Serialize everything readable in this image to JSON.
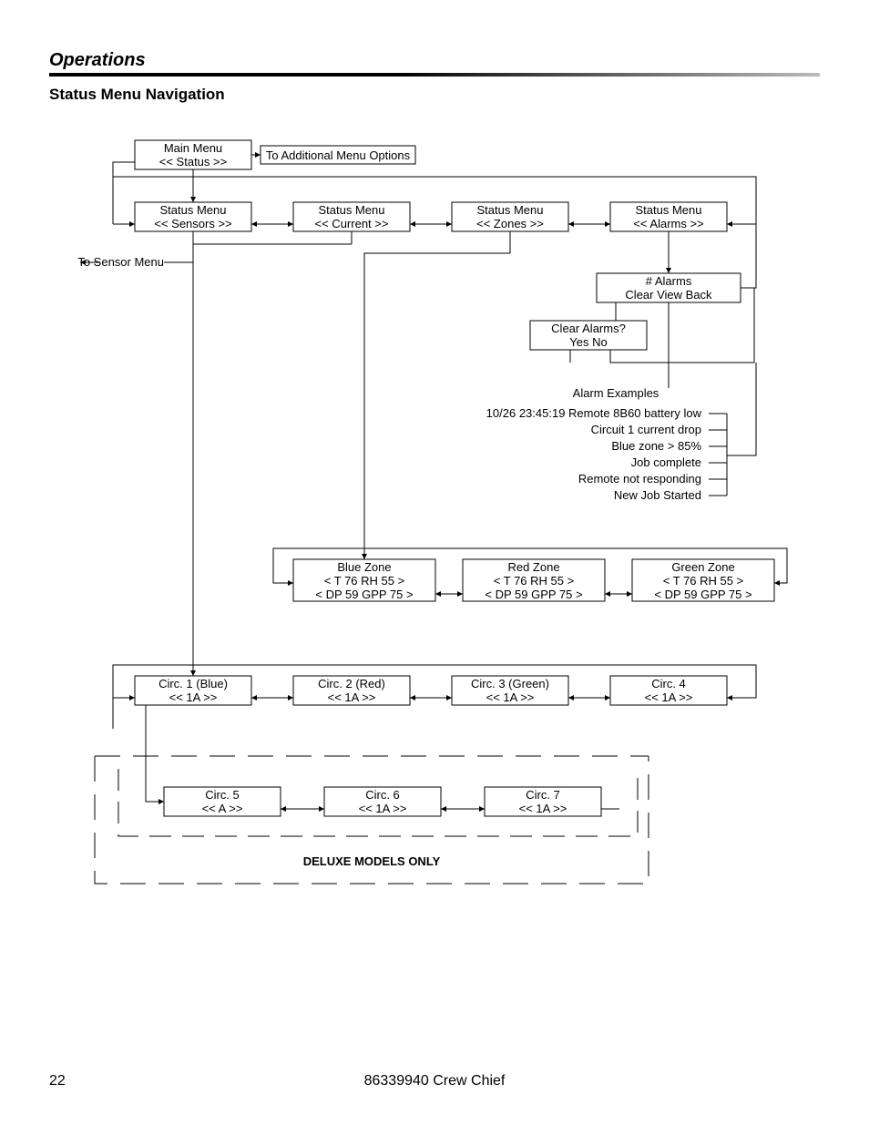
{
  "header": {
    "section": "Operations",
    "subtitle": "Status Menu Navigation"
  },
  "footer": {
    "page": "22",
    "doc": "86339940  Crew Chief"
  },
  "mainMenu": {
    "title": "Main Menu",
    "nav": "<<    Status    >>",
    "aside": "To Additional Menu Options"
  },
  "statusRow": {
    "sensors": {
      "title": "Status Menu",
      "nav": "<<   Sensors   >>"
    },
    "current": {
      "title": "Status Menu",
      "nav": "<<   Current   >>"
    },
    "zones": {
      "title": "Status Menu",
      "nav": "<<   Zones   >>"
    },
    "alarms": {
      "title": "Status Menu",
      "nav": "<<   Alarms   >>"
    }
  },
  "sensorLink": "To Sensor Menu",
  "alarmsBox": {
    "title": "# Alarms",
    "opts": "Clear     View      Back"
  },
  "clearBox": {
    "title": "Clear Alarms?",
    "opts": "Yes    No"
  },
  "alarmExamples": {
    "heading": "Alarm Examples",
    "items": [
      "10/26 23:45:19 Remote 8B60 battery low",
      "Circuit 1 current drop",
      "Blue zone > 85%",
      "Job complete",
      "Remote not responding",
      "New Job Started"
    ]
  },
  "zones": {
    "blue": {
      "title": "Blue Zone",
      "l1": "<  T 76          RH 55  >",
      "l2": "<  DP 59       GPP 75  >"
    },
    "red": {
      "title": "Red Zone",
      "l1": "<  T 76          RH 55  >",
      "l2": "<  DP 59       GPP 75  >"
    },
    "green": {
      "title": "Green Zone",
      "l1": "<  T 76          RH 55  >",
      "l2": "<  DP 59       GPP 75  >"
    }
  },
  "circuitsA": {
    "c1": {
      "title": "Circ. 1     (Blue)",
      "nav": "<<       1A       >>"
    },
    "c2": {
      "title": "Circ. 2     (Red)",
      "nav": "<<       1A       >>"
    },
    "c3": {
      "title": "Circ. 3   (Green)",
      "nav": "<<       1A       >>"
    },
    "c4": {
      "title": "Circ. 4",
      "nav": "<<       1A       >>"
    }
  },
  "circuitsB": {
    "c5": {
      "title": "Circ. 5",
      "nav": "<<        A        >>"
    },
    "c6": {
      "title": "Circ. 6",
      "nav": "<<       1A       >>"
    },
    "c7": {
      "title": "Circ. 7",
      "nav": "<<       1A       >>"
    }
  },
  "deluxe": "DELUXE MODELS ONLY"
}
